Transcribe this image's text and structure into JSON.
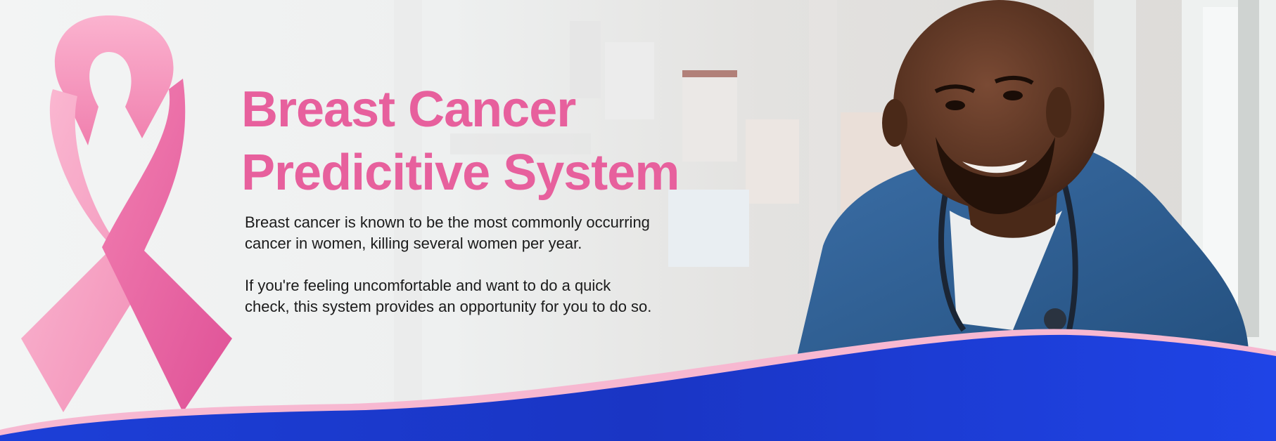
{
  "banner": {
    "title_line1": "Breast Cancer",
    "title_line2": "Predicitive System",
    "paragraph1_line1": "Breast cancer is known to be the most commonly occurring",
    "paragraph1_line2": "cancer in women, killing several women per year.",
    "paragraph2_line1": "If you're feeling uncomfortable and want to do a quick",
    "paragraph2_line2": "check, this system provides an opportunity for you to do so."
  },
  "icons": {
    "ribbon": "pink-awareness-ribbon-icon",
    "photo": "doctor-photo"
  },
  "colors": {
    "title_pink": "#e7609d",
    "ribbon_light": "#f9a9c8",
    "ribbon_dark": "#e0589a",
    "wave_blue": "#1f3ee0",
    "wave_border_pink": "#f6b6cf",
    "text_dark": "#1b1b1b",
    "scrub_blue": "#2f5f94"
  }
}
